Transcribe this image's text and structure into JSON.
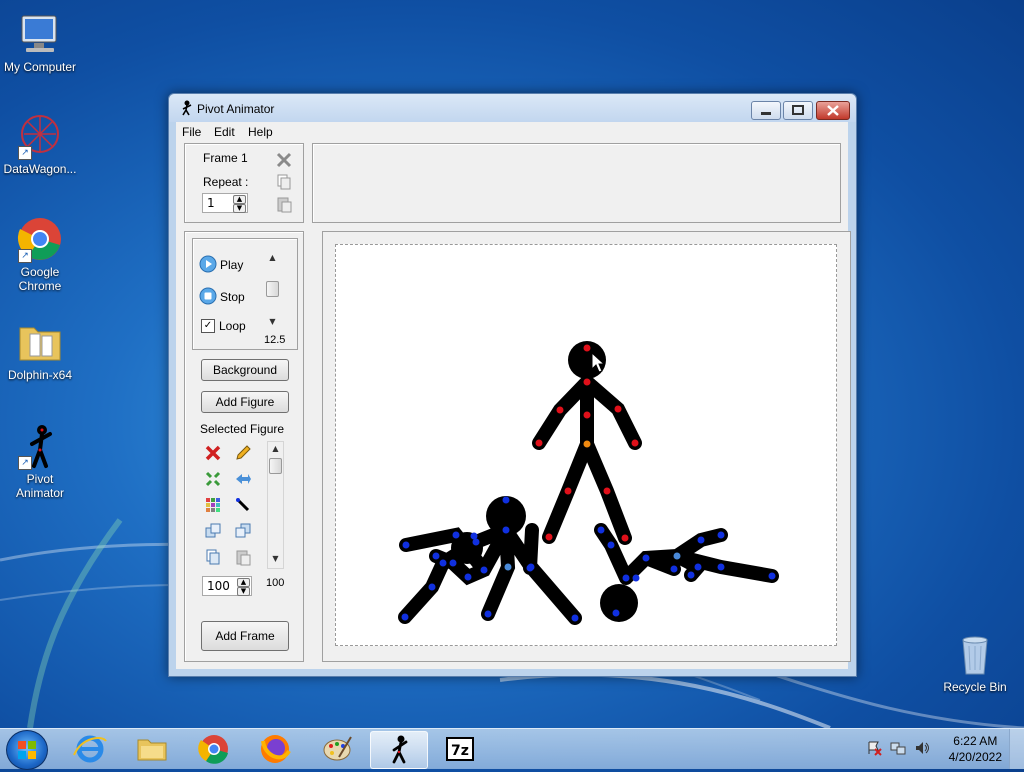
{
  "desktop": {
    "icons": [
      {
        "label": "My Computer"
      },
      {
        "label": "DataWagon..."
      },
      {
        "label": "Google\nChrome"
      },
      {
        "label": "Dolphin-x64"
      },
      {
        "label": "Pivot\nAnimator"
      },
      {
        "label": "Recycle Bin"
      }
    ]
  },
  "window": {
    "title": "Pivot Animator",
    "menu": [
      "File",
      "Edit",
      "Help"
    ],
    "frame_panel": {
      "frame_label": "Frame 1",
      "repeat_label": "Repeat :",
      "repeat_value": "1"
    },
    "playback": {
      "play_label": "Play",
      "stop_label": "Stop",
      "loop_label": "Loop",
      "loop_checked": true,
      "speed_value": "12.5"
    },
    "buttons": {
      "background": "Background",
      "add_figure": "Add Figure",
      "add_frame": "Add Frame"
    },
    "selected_figure": {
      "title": "Selected Figure",
      "size_value": "100",
      "scroll_value": "100"
    }
  },
  "taskbar": {
    "time": "6:22 AM",
    "date": "4/20/2022"
  },
  "colors": {
    "joint_red": "#e0101a",
    "joint_blue": "#1030e0",
    "joint_orange": "#f08a10",
    "figure": "#000000"
  }
}
